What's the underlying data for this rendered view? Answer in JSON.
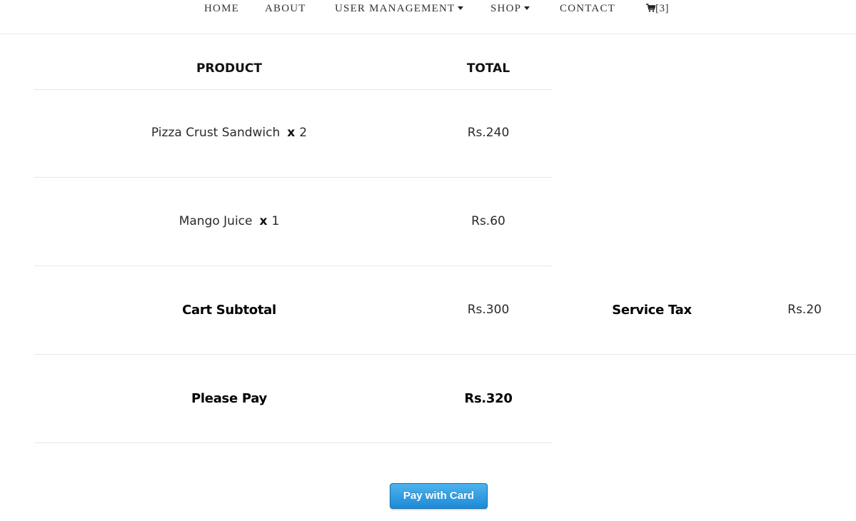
{
  "nav": {
    "home": "HOME",
    "about": "ABOUT",
    "user_management": "USER MANAGEMENT",
    "shop": "SHOP",
    "contact": "CONTACT",
    "cart_count": "[3]"
  },
  "table": {
    "headers": {
      "product": "PRODUCT",
      "total": "TOTAL"
    },
    "items": [
      {
        "name": "Pizza Crust Sandwich",
        "x": "x",
        "qty": "2",
        "total": "Rs.240"
      },
      {
        "name": "Mango Juice",
        "x": "x",
        "qty": "1",
        "total": "Rs.60"
      }
    ],
    "subtotal": {
      "label": "Cart Subtotal",
      "value": "Rs.300"
    },
    "service_tax": {
      "label": "Service Tax",
      "value": "Rs.20"
    },
    "please_pay": {
      "label": "Please Pay",
      "value": "Rs.320"
    }
  },
  "pay_button": {
    "label": "Pay with Card"
  },
  "icons": {
    "cart": "cart-icon",
    "caret": "caret-down-icon"
  },
  "colors": {
    "button": "#2a9be3",
    "divider": "#e7e7e7"
  }
}
